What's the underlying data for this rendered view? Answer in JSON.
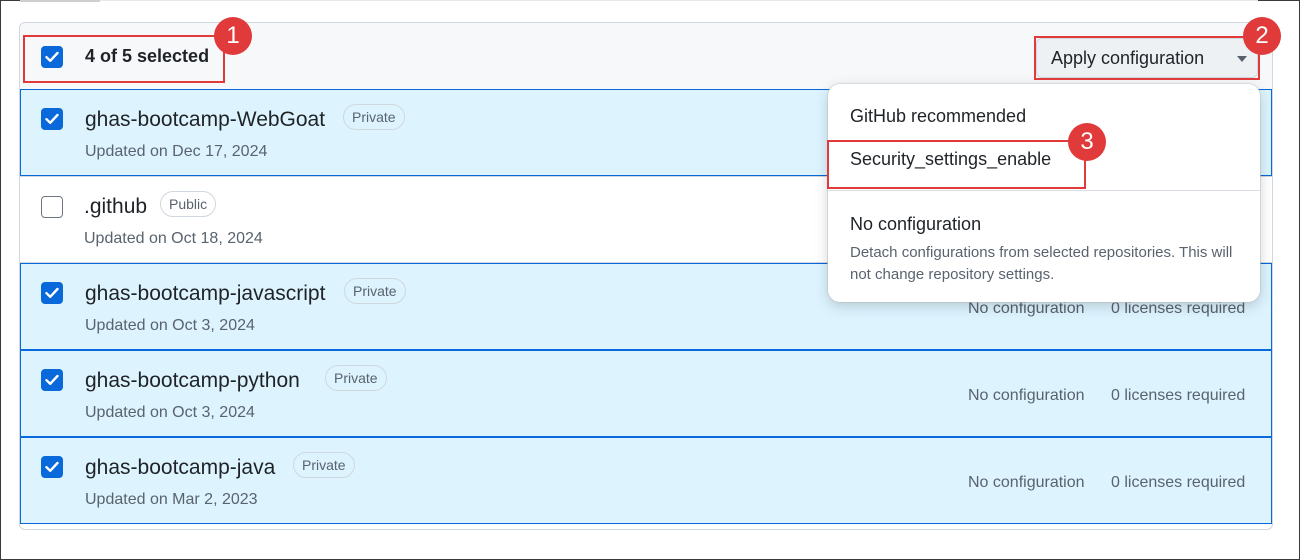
{
  "header": {
    "selection_count": "4 of 5 selected",
    "apply_button_label": "Apply configuration"
  },
  "repositories": [
    {
      "name": "ghas-bootcamp-WebGoat",
      "visibility": "Private",
      "updated": "Updated on Dec 17, 2024",
      "selected": true,
      "configuration": "",
      "licenses": ""
    },
    {
      "name": ".github",
      "visibility": "Public",
      "updated": "Updated on Oct 18, 2024",
      "selected": false,
      "configuration": "",
      "licenses": ""
    },
    {
      "name": "ghas-bootcamp-javascript",
      "visibility": "Private",
      "updated": "Updated on Oct 3, 2024",
      "selected": true,
      "configuration": "No configuration",
      "licenses": "0 licenses required"
    },
    {
      "name": "ghas-bootcamp-python",
      "visibility": "Private",
      "updated": "Updated on Oct 3, 2024",
      "selected": true,
      "configuration": "No configuration",
      "licenses": "0 licenses required"
    },
    {
      "name": "ghas-bootcamp-java",
      "visibility": "Private",
      "updated": "Updated on Mar 2, 2023",
      "selected": true,
      "configuration": "No configuration",
      "licenses": "0 licenses required"
    }
  ],
  "dropdown": {
    "items": [
      {
        "label": "GitHub recommended"
      },
      {
        "label": "Security_settings_enable"
      },
      {
        "label": "No configuration",
        "description": "Detach configurations from selected repositories. This will not change repository settings."
      }
    ]
  },
  "annotations": [
    "1",
    "2",
    "3"
  ],
  "colors": {
    "accent": "#0969da",
    "selected_row_bg": "#ddf4ff",
    "annotation_red": "#e03a3a"
  }
}
